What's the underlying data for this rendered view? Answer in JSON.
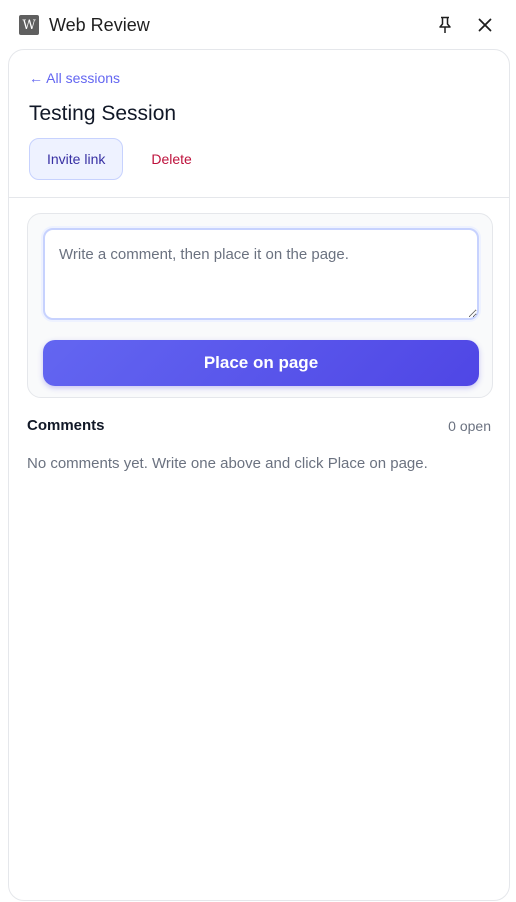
{
  "window": {
    "app_icon_letter": "W",
    "title": "Web Review",
    "pin_icon": "pin-icon",
    "close_icon": "close-icon"
  },
  "session": {
    "back_label": "← All sessions",
    "title": "Testing Session",
    "invite_label": "Invite link",
    "delete_label": "Delete"
  },
  "composer": {
    "placeholder": "Write a comment, then place it on the page.",
    "value": "",
    "place_label": "Place on page"
  },
  "comments": {
    "heading": "Comments",
    "open_count": "0 open",
    "empty_message": "No comments yet. Write one above and click Place on page."
  },
  "colors": {
    "accent": "#6366f1",
    "accent_dark": "#4f46e5",
    "danger": "#be123c"
  }
}
